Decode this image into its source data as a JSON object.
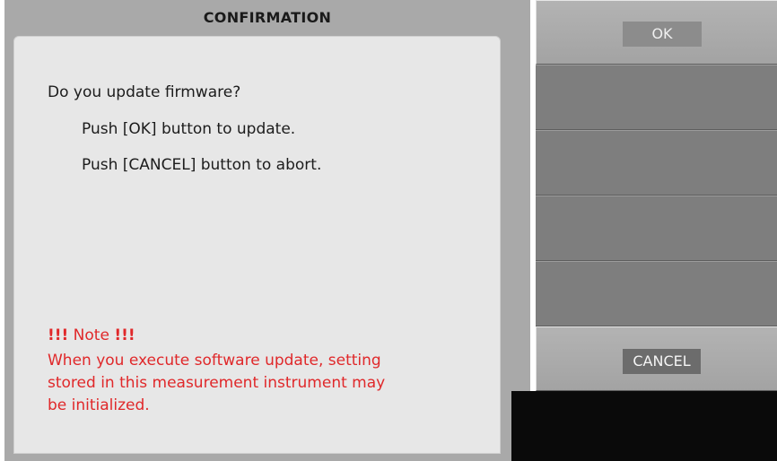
{
  "dialog": {
    "title": "CONFIRMATION",
    "question": "Do you update firmware?",
    "ok_instruction": "Push [OK] button to update.",
    "cancel_instruction": "Push [CANCEL] button to abort.",
    "note": {
      "bang_left": "!!!",
      "label": "Note",
      "bang_right": "!!!",
      "lines": [
        "When you execute software update, setting",
        "stored in this measurement instrument may",
        "be initialized."
      ],
      "color": "#e0282a"
    }
  },
  "softkeys": {
    "ok_label": "OK",
    "cancel_label": "CANCEL"
  }
}
